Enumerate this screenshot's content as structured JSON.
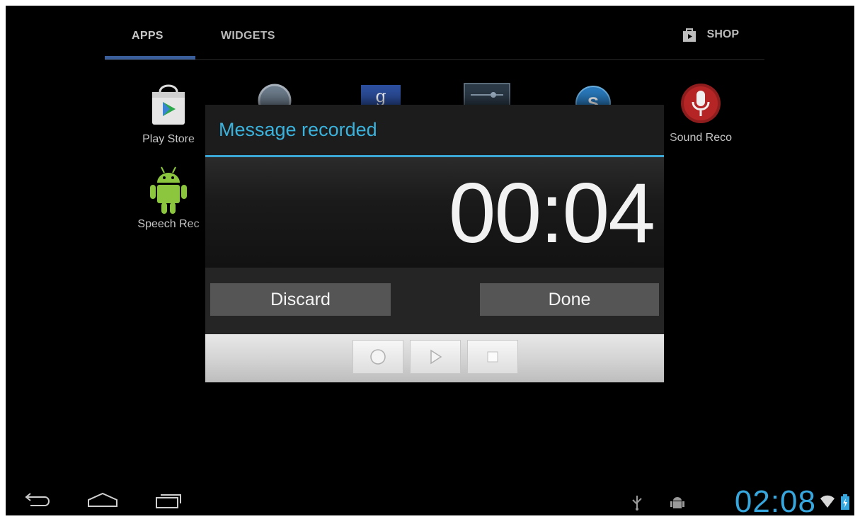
{
  "tabs": {
    "apps_label": "APPS",
    "widgets_label": "WIDGETS",
    "shop_label": "SHOP"
  },
  "apps": [
    {
      "label": "Play Store",
      "icon": "play-store-icon"
    },
    {
      "label": "",
      "icon": "search-app-icon"
    },
    {
      "label": "",
      "icon": "google-icon"
    },
    {
      "label": "",
      "icon": "settings-app-icon"
    },
    {
      "label": "",
      "icon": "skype-icon"
    },
    {
      "label": "Sound Reco",
      "icon": "microphone-icon"
    },
    {
      "label": "Speech Rec",
      "icon": "android-icon"
    }
  ],
  "dialog": {
    "title": "Message recorded",
    "timer": "00:04",
    "discard_label": "Discard",
    "done_label": "Done",
    "controls": [
      "record-icon",
      "play-icon",
      "stop-icon"
    ]
  },
  "status": {
    "clock": "02:08",
    "icons": [
      "usb-icon",
      "android-debug-icon",
      "wifi-icon",
      "battery-icon"
    ]
  },
  "navbar": {
    "icons": [
      "back-icon",
      "home-icon",
      "recent-apps-icon"
    ]
  },
  "colors": {
    "accent": "#3ab2dc",
    "tab_underline": "#3a5e9a",
    "button_bg": "#555555",
    "background": "#000000"
  }
}
